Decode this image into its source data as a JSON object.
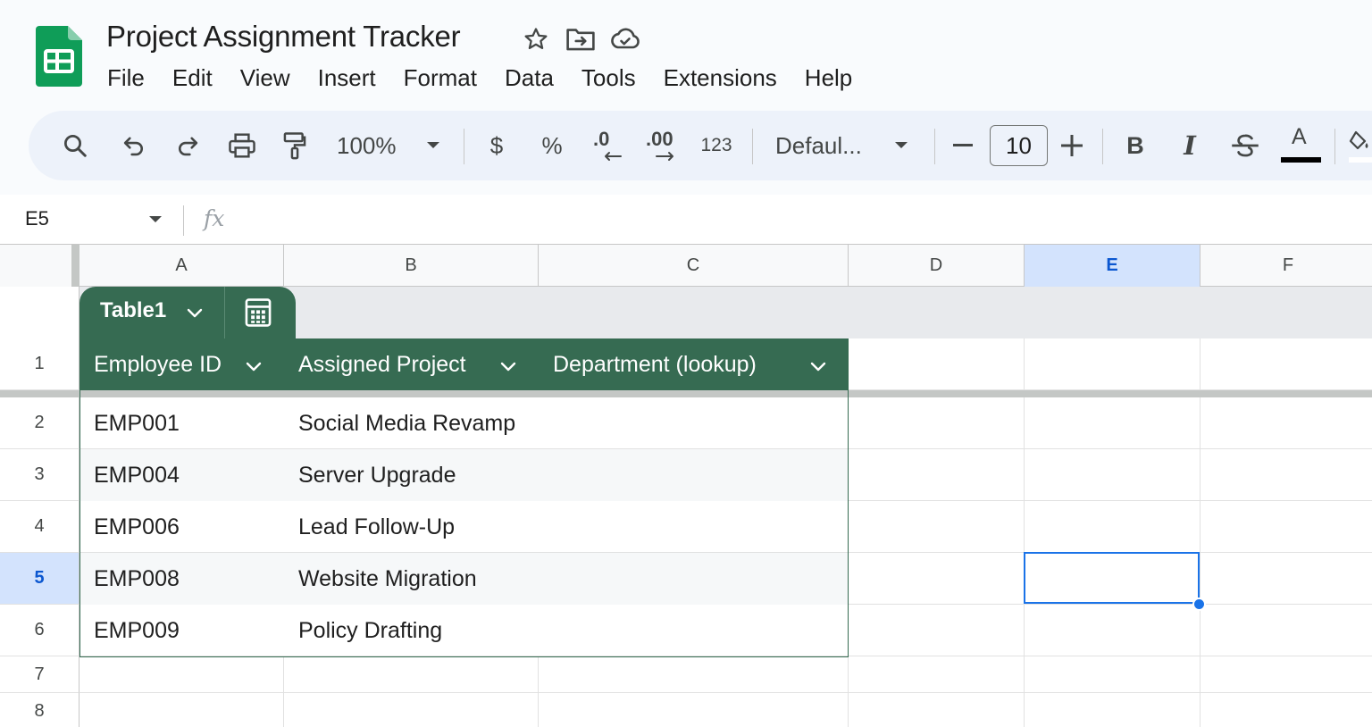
{
  "app": {
    "document_title": "Project Assignment Tracker",
    "brand_color": "#0f9d58"
  },
  "menu": [
    "File",
    "Edit",
    "View",
    "Insert",
    "Format",
    "Data",
    "Tools",
    "Extensions",
    "Help"
  ],
  "toolbar": {
    "zoom": "100%",
    "currency": "$",
    "percent": "%",
    "decrease_decimal": ".0",
    "increase_decimal": ".00",
    "number_format": "123",
    "font": "Defaul...",
    "font_size": "10",
    "bold": "B",
    "italic": "I",
    "text_color_label": "A",
    "text_color": "#000000"
  },
  "formula_bar": {
    "cell_ref": "E5",
    "fx_label": "fx",
    "value": ""
  },
  "grid": {
    "columns": [
      "A",
      "B",
      "C",
      "D",
      "E",
      "F"
    ],
    "selected_column": "E",
    "rows": [
      "1",
      "2",
      "3",
      "4",
      "5",
      "6",
      "7",
      "8"
    ],
    "selected_row": "5",
    "selected_cell": "E5",
    "selection_color": "#1a73e8"
  },
  "table": {
    "name": "Table1",
    "header_color": "#366b52",
    "headers": [
      "Employee ID",
      "Assigned Project",
      "Department (lookup)"
    ],
    "rows": [
      [
        "EMP001",
        "Social Media Revamp",
        ""
      ],
      [
        "EMP004",
        "Server Upgrade",
        ""
      ],
      [
        "EMP006",
        "Lead Follow-Up",
        ""
      ],
      [
        "EMP008",
        "Website Migration",
        ""
      ],
      [
        "EMP009",
        "Policy Drafting",
        ""
      ]
    ]
  }
}
